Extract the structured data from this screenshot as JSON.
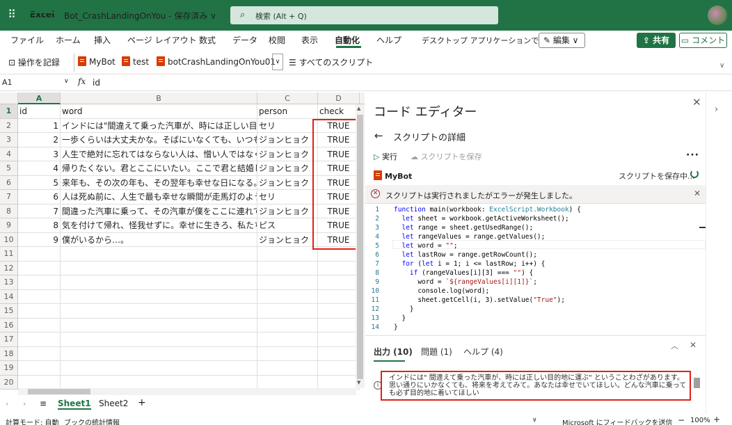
{
  "titlebar": {
    "app": "Excel",
    "doc": "Bot_CrashLandingOnYou - 保存済み ∨",
    "search": "検索 (Alt + Q)"
  },
  "menu": {
    "tabs": [
      "ファイル",
      "ホーム",
      "挿入",
      "ページ レイアウト",
      "数式",
      "データ",
      "校閲",
      "表示",
      "自動化",
      "ヘルプ",
      "デスクトップ アプリケーションで開く"
    ],
    "active": "自動化",
    "edit": "✎ 編集 ∨",
    "share": "共有",
    "comment": "コメント"
  },
  "ribbon": {
    "record": "操作を記録",
    "scripts": [
      "MyBot",
      "test",
      "botCrashLandingOnYou01"
    ],
    "all_scripts": "すべてのスクリプト"
  },
  "formula": {
    "namebox": "A1",
    "fx": "fx",
    "value": "id"
  },
  "grid": {
    "columns": [
      "A",
      "B",
      "C",
      "D"
    ],
    "rows": [
      [
        "id",
        "word",
        "person",
        "check"
      ],
      [
        "1",
        "インドには\"間違えて乗った汽車が、時には正しい目",
        "セリ",
        "TRUE"
      ],
      [
        "2",
        "一歩くらいは大丈夫かな。そばにいなくても、いつも",
        "ジョンヒョク",
        "TRUE"
      ],
      [
        "3",
        "人生で絶対に忘れてはならない人は、憎い人ではなく",
        "ジョンヒョク",
        "TRUE"
      ],
      [
        "4",
        "帰りたくない。君とここにいたい。ここで君と結婚し",
        "ジョンヒョク",
        "TRUE"
      ],
      [
        "5",
        "来年も、その次の年も、その翌年も幸せな日になる。",
        "ジョンヒョク",
        "TRUE"
      ],
      [
        "6",
        "人は死ぬ前に、人生で最も幸せな瞬間が走馬灯のよう",
        "セリ",
        "TRUE"
      ],
      [
        "7",
        "間違った汽車に乗って、その汽車が僕をここに連れて",
        "ジョンヒョク",
        "TRUE"
      ],
      [
        "8",
        "気を付けて帰れ、怪我せずに。幸せに生きろ、私たち",
        "ピス",
        "TRUE"
      ],
      [
        "9",
        "僕がいるから…。",
        "ジョンヒョク",
        "TRUE"
      ]
    ],
    "row_numbers": [
      "1",
      "2",
      "3",
      "4",
      "5",
      "6",
      "7",
      "8",
      "9",
      "10",
      "11",
      "12",
      "13",
      "14",
      "15",
      "16",
      "17",
      "18",
      "19",
      "20"
    ]
  },
  "sheets": {
    "tabs": [
      "Sheet1",
      "Sheet2"
    ],
    "active": "Sheet1",
    "add": "+"
  },
  "status": {
    "calc": "計算モード: 自動",
    "stats": "ブックの統計情報",
    "feedback": "Microsoft にフィードバックを送信",
    "zoom": "100%"
  },
  "editor": {
    "title": "コード エディター",
    "detail": "スクリプトの詳細",
    "run": "実行",
    "save": "スクリプトを保存",
    "script_name": "MyBot",
    "saving": "スクリプトを保存中...",
    "error": "スクリプトは実行されましたがエラーが発生しました。",
    "code": [
      "function main(workbook: ExcelScript.Workbook) {",
      "  let sheet = workbook.getActiveWorksheet();",
      "  let range = sheet.getUsedRange();",
      "  let rangeValues = range.getValues();",
      "  let word = \"\";",
      "  let lastRow = range.getRowCount();",
      "  for (let i = 1; i <= lastRow; i++) {",
      "    if (rangeValues[i][3] === \"\") {",
      "      word = `${rangeValues[i][1]}`;",
      "      console.log(word);",
      "      sheet.getCell(i, 3).setValue(\"True\");",
      "    }",
      "  }",
      "}"
    ],
    "output_tabs": [
      "出力 (10)",
      "問題 (1)",
      "ヘルプ (4)"
    ],
    "output_text": "インドには\" 間違えて乗った汽車が、時には正しい目的地に運ぶ\" ということわざがあります。思い通りにいかなくても、将来を考えてみて。あなたは幸せでいてほしい。どんな汽車に乗っても必ず目的地に着いてほしい"
  }
}
